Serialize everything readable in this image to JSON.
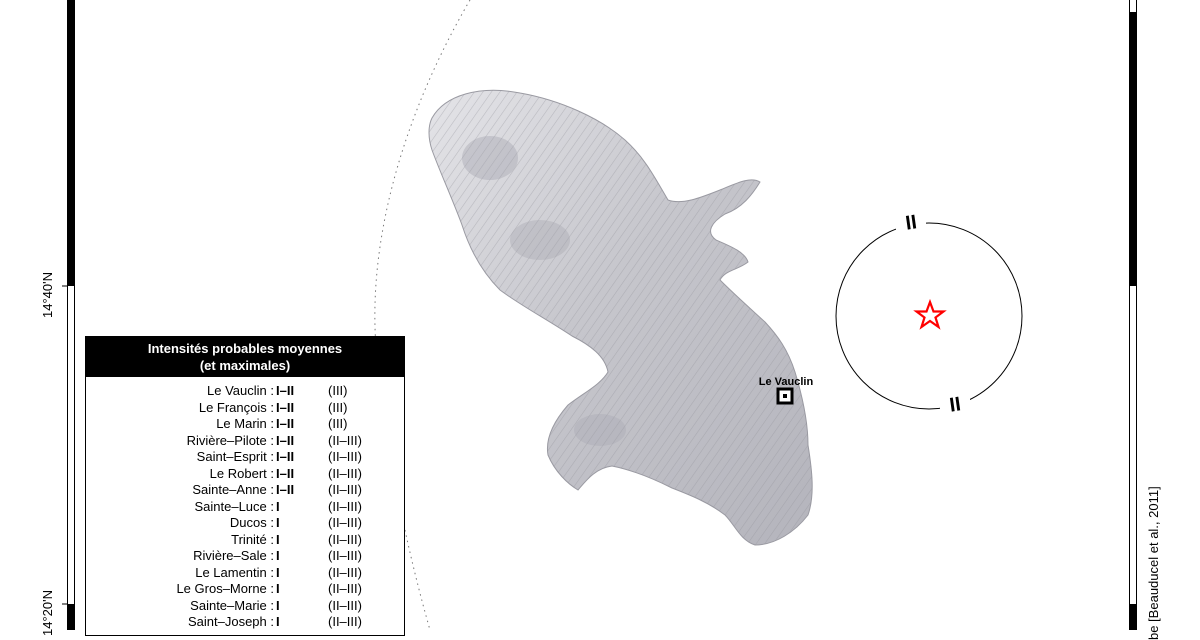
{
  "map": {
    "lat_labels": [
      "14°40'N",
      "14°20'N"
    ],
    "credit": "be [Beauducel et al., 2011]",
    "epicenter": {
      "color": "#ff0000",
      "icon": "star-icon"
    },
    "intensity_ring_labels": [
      "II",
      "II"
    ],
    "city_marker": {
      "label": "Le Vauclin",
      "icon": "square-marker-icon"
    }
  },
  "legend": {
    "title_line1": "Intensités probables moyennes",
    "title_line2": "(et maximales)",
    "rows": [
      {
        "city": "Le Vauclin :",
        "avg": "I–II",
        "max": "(III)"
      },
      {
        "city": "Le François :",
        "avg": "I–II",
        "max": "(III)"
      },
      {
        "city": "Le Marin :",
        "avg": "I–II",
        "max": "(III)"
      },
      {
        "city": "Rivière–Pilote :",
        "avg": "I–II",
        "max": "(II–III)"
      },
      {
        "city": "Saint–Esprit :",
        "avg": "I–II",
        "max": "(II–III)"
      },
      {
        "city": "Le Robert :",
        "avg": "I–II",
        "max": "(II–III)"
      },
      {
        "city": "Sainte–Anne :",
        "avg": "I–II",
        "max": "(II–III)"
      },
      {
        "city": "Sainte–Luce :",
        "avg": "I",
        "max": "(II–III)"
      },
      {
        "city": "Ducos :",
        "avg": "I",
        "max": "(II–III)"
      },
      {
        "city": "Trinité :",
        "avg": "I",
        "max": "(II–III)"
      },
      {
        "city": "Rivière–Sale :",
        "avg": "I",
        "max": "(II–III)"
      },
      {
        "city": "Le Lamentin :",
        "avg": "I",
        "max": "(II–III)"
      },
      {
        "city": "Le Gros–Morne :",
        "avg": "I",
        "max": "(II–III)"
      },
      {
        "city": "Sainte–Marie :",
        "avg": "I",
        "max": "(II–III)"
      },
      {
        "city": "Saint–Joseph :",
        "avg": "I",
        "max": "(II–III)"
      }
    ]
  }
}
